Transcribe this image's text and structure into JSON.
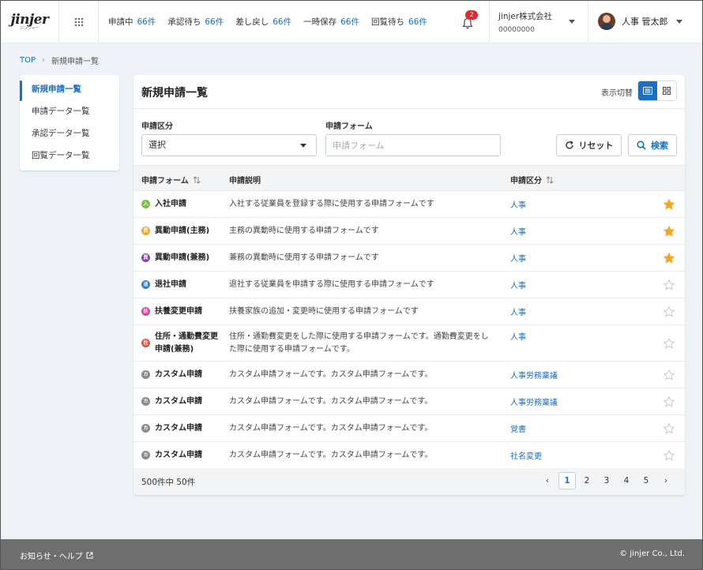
{
  "header": {
    "logo_main": "jinjer",
    "logo_sub": "ジンジャー",
    "status": [
      {
        "label": "申請中",
        "count": "66件"
      },
      {
        "label": "承認待ち",
        "count": "66件"
      },
      {
        "label": "差し戻し",
        "count": "66件"
      },
      {
        "label": "一時保存",
        "count": "66件"
      },
      {
        "label": "回覧待ち",
        "count": "66件"
      }
    ],
    "notification_count": "2",
    "company_name": "jinjer株式会社",
    "company_code": "00000000",
    "user_name": "人事 管太郎"
  },
  "breadcrumb": {
    "top": "TOP",
    "separator": "›",
    "current": "新規申請一覧"
  },
  "sidebar": {
    "items": [
      {
        "label": "新規申請一覧"
      },
      {
        "label": "申請データ一覧"
      },
      {
        "label": "承認データ一覧"
      },
      {
        "label": "回覧データ一覧"
      }
    ]
  },
  "main": {
    "title": "新規申請一覧",
    "view_label": "表示切替",
    "filter": {
      "category_label": "申請区分",
      "category_value": "選択",
      "form_label": "申請フォーム",
      "form_placeholder": "申請フォーム",
      "reset_label": "リセット",
      "search_label": "検索"
    },
    "table": {
      "headers": {
        "form": "申請フォーム",
        "desc": "申請説明",
        "category": "申請区分"
      },
      "rows": [
        {
          "form": "入社申請",
          "desc": "入社する従業員を登録する際に使用する申請フォームです",
          "category": "人事",
          "icon": "入",
          "icon_color": "#7cc242",
          "starred": true
        },
        {
          "form": "異動申請(主務)",
          "desc": "主務の異動時に使用する申請フォームです",
          "category": "人事",
          "icon": "異",
          "icon_color": "#f5a623",
          "starred": true
        },
        {
          "form": "異動申請(兼務)",
          "desc": "兼務の異動時に使用する申請フォームです",
          "category": "人事",
          "icon": "異",
          "icon_color": "#8e44ad",
          "starred": true
        },
        {
          "form": "退社申請",
          "desc": "退社する従業員を申請する際に使用する申請フォームです",
          "category": "人事",
          "icon": "退",
          "icon_color": "#2d7be0",
          "starred": false
        },
        {
          "form": "扶養変更申請",
          "desc": "扶養家族の追加・変更時に使用する申請フォームです",
          "category": "人事",
          "icon": "扶",
          "icon_color": "#e0409a",
          "starred": false
        },
        {
          "form": "住所・通勤費変更申請(兼務)",
          "desc": "住所・通勤費変更をした際に使用する申請フォームです。通勤費変更をした際に使用する申請フォームです。",
          "category": "人事",
          "icon": "住",
          "icon_color": "#e8523f",
          "starred": false
        },
        {
          "form": "カスタム申請",
          "desc": "カスタム申請フォームです。カスタム申請フォームです。",
          "category": "人事労務稟議",
          "icon": "カ",
          "icon_color": "#8a8a8a",
          "starred": false
        },
        {
          "form": "カスタム申請",
          "desc": "カスタム申請フォームです。カスタム申請フォームです。",
          "category": "人事労務稟議",
          "icon": "カ",
          "icon_color": "#8a8a8a",
          "starred": false
        },
        {
          "form": "カスタム申請",
          "desc": "カスタム申請フォームです。カスタム申請フォームです。",
          "category": "覚書",
          "icon": "カ",
          "icon_color": "#8a8a8a",
          "starred": false
        },
        {
          "form": "カスタム申請",
          "desc": "カスタム申請フォームです。カスタム申請フォームです。",
          "category": "社名変更",
          "icon": "カ",
          "icon_color": "#8a8a8a",
          "starred": false
        }
      ]
    },
    "pagination": {
      "total": "500件中 50件",
      "prev": "‹",
      "next": "›",
      "pages": [
        "1",
        "2",
        "3",
        "4",
        "5"
      ],
      "current": "1"
    }
  },
  "footer": {
    "help": "お知らせ・ヘルプ",
    "copyright": "© jinjer Co., Ltd."
  },
  "colors": {
    "accent": "#1a6fc4",
    "star": "#f5a623",
    "badge": "#e02b2b"
  }
}
